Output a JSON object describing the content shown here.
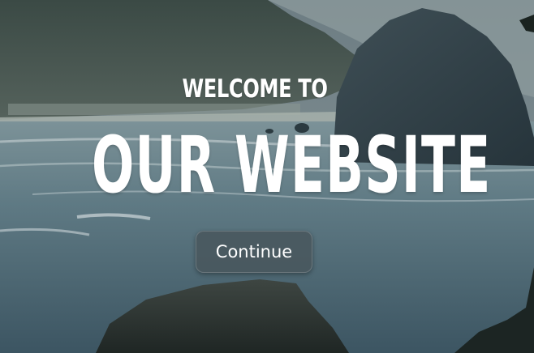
{
  "hero": {
    "eyebrow": "WELCOME TO",
    "title": "OUR WEBSITE",
    "cta_label": "Continue",
    "background": "coastal-sea-stacks-photo"
  },
  "colors": {
    "text": "#ffffff",
    "button_bg": "#48565c",
    "sea": "#4f6b78",
    "rock": "#2f3f47"
  }
}
